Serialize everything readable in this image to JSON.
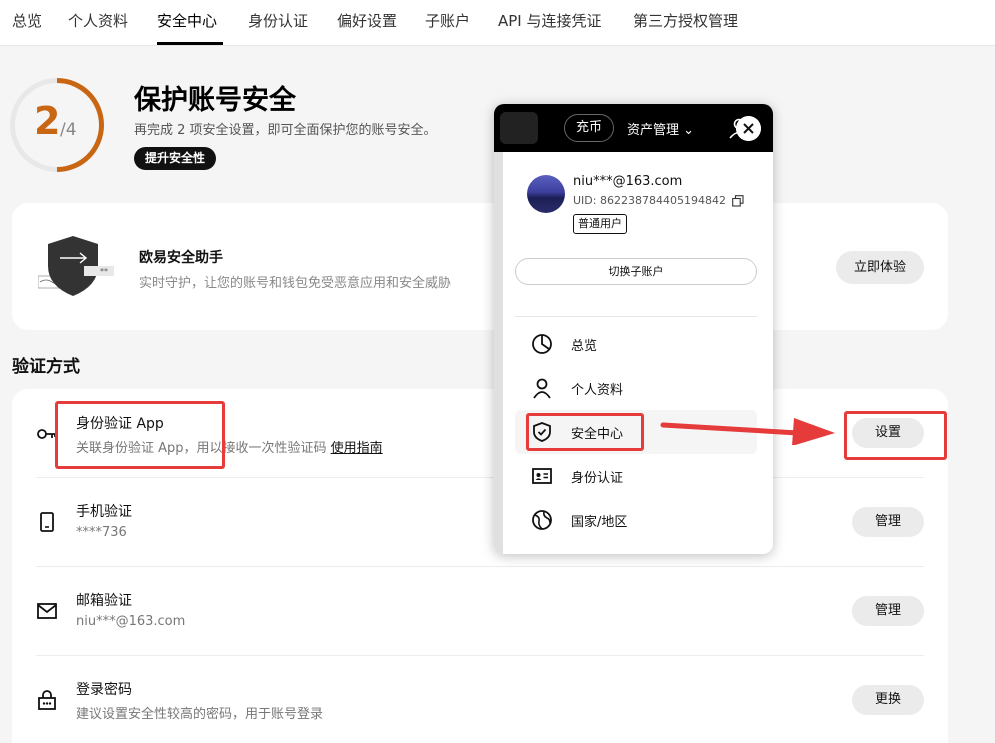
{
  "nav": {
    "tabs": [
      "总览",
      "个人资料",
      "安全中心",
      "身份认证",
      "偏好设置",
      "子账户",
      "API 与连接凭证",
      "第三方授权管理"
    ],
    "active_index": 2
  },
  "hero": {
    "done": "2",
    "total": "/4",
    "progress_fraction": 0.5,
    "title": "保护账号安全",
    "desc": "再完成 2 项安全设置，即可全面保护您的账号安全。",
    "button": "提升安全性"
  },
  "assistant": {
    "title": "欧易安全助手",
    "desc": "实时守护，让您的账号和钱包免受恶意应用和安全威胁",
    "button": "立即体验"
  },
  "methods": {
    "section_title": "验证方式",
    "items": [
      {
        "icon": "key-icon",
        "title": "身份验证 App",
        "desc": "关联身份验证 App，用以接收一次性验证码",
        "link": "使用指南",
        "button": "设置"
      },
      {
        "icon": "phone-icon",
        "title": "手机验证",
        "desc": "****736",
        "button": "管理"
      },
      {
        "icon": "mail-icon",
        "title": "邮箱验证",
        "desc": "niu***@163.com",
        "button": "管理"
      },
      {
        "icon": "lock-password-icon",
        "title": "登录密码",
        "desc": "建议设置安全性较高的密码，用于账号登录",
        "button": "更换"
      }
    ]
  },
  "popup": {
    "recharge": "充币",
    "assets": "资产管理",
    "email": "niu***@163.com",
    "uid": "UID: 862238784405194842",
    "badge": "普通用户",
    "switch": "切换子账户",
    "menu": [
      {
        "icon": "pie-chart-icon",
        "label": "总览"
      },
      {
        "icon": "person-icon",
        "label": "个人资料"
      },
      {
        "icon": "shield-check-icon",
        "label": "安全中心"
      },
      {
        "icon": "id-card-icon",
        "label": "身份认证"
      },
      {
        "icon": "globe-icon",
        "label": "国家/地区"
      }
    ]
  },
  "colors": {
    "accent_orange": "#c96614",
    "annotation_red": "#e63b3b",
    "dark": "#111111"
  }
}
